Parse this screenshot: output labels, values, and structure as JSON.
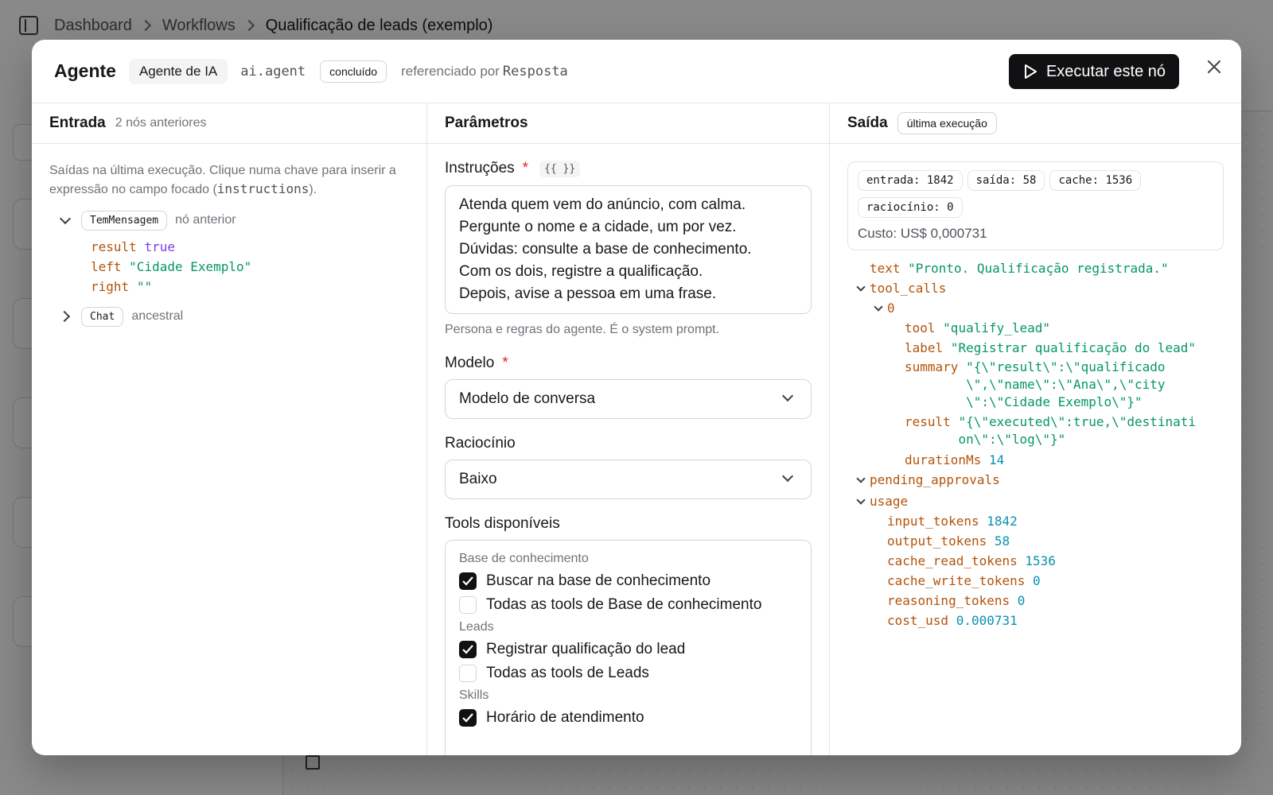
{
  "breadcrumb": [
    "Dashboard",
    "Workflows",
    "Qualificação de leads (exemplo)"
  ],
  "modal": {
    "title": "Agente",
    "kind_label": "Agente de IA",
    "type": "ai.agent",
    "status": "concluído",
    "referenced_by_label": "referenciado por",
    "referenced_by": "Resposta",
    "run_button": "Executar este nó",
    "close_icon": "close-icon"
  },
  "entrada": {
    "title": "Entrada",
    "subtitle": "2 nós anteriores",
    "hint_before": "Saídas na última execução. Clique numa chave para inserir a expressão no campo focado (",
    "hint_code": "instructions",
    "hint_after": ").",
    "nodes": [
      {
        "name": "TemMensagem",
        "tag": "nó anterior",
        "expanded": true,
        "fields": [
          {
            "key": "result",
            "value": "true"
          },
          {
            "key": "left",
            "value": "\"Cidade Exemplo\""
          },
          {
            "key": "right",
            "value": "\"\""
          }
        ]
      },
      {
        "name": "Chat",
        "tag": "ancestral",
        "expanded": false
      }
    ]
  },
  "parametros": {
    "title": "Parâmetros",
    "instructions_label": "Instruções",
    "required_mark": "*",
    "expr_badge": "{{ }}",
    "instructions_lines": [
      "Atenda quem vem do anúncio, com calma.",
      "Pergunte o nome e a cidade, um por vez.",
      "Dúvidas: consulte a base de conhecimento.",
      "Com os dois, registre a qualificação.",
      "Depois, avise a pessoa em uma frase."
    ],
    "instructions_help": "Persona e regras do agente. É o system prompt.",
    "model_label": "Modelo",
    "model_value": "Modelo de conversa",
    "reasoning_label": "Raciocínio",
    "reasoning_value": "Baixo",
    "tools_label": "Tools disponíveis",
    "tool_groups": [
      {
        "label": "Base de conhecimento",
        "items": [
          {
            "label": "Buscar na base de conhecimento",
            "checked": true
          },
          {
            "label": "Todas as tools de Base de conhecimento",
            "checked": false
          }
        ]
      },
      {
        "label": "Leads",
        "items": [
          {
            "label": "Registrar qualificação do lead",
            "checked": true
          },
          {
            "label": "Todas as tools de Leads",
            "checked": false
          }
        ]
      },
      {
        "label": "Skills",
        "items": [
          {
            "label": "Horário de atendimento",
            "checked": true
          }
        ]
      }
    ]
  },
  "saida": {
    "title": "Saída",
    "badge": "última execução",
    "chips": [
      "entrada: 1842",
      "saída: 58",
      "cache: 1536",
      "raciocínio: 0"
    ],
    "cost": "Custo: US$ 0,000731",
    "text_key": "text",
    "text_value": "\"Pronto. Qualificação registrada.\"",
    "tool_calls_key": "tool_calls",
    "index_key": "0",
    "call": {
      "tool_key": "tool",
      "tool_value": "\"qualify_lead\"",
      "label_key": "label",
      "label_value": "\"Registrar qualificação do lead\"",
      "summary_key": "summary",
      "summary_value": "\"{\\\"result\\\":\\\"qualificado\\\",\\\"name\\\":\\\"Ana\\\",\\\"city\\\":\\\"Cidade Exemplo\\\"}\"",
      "result_key": "result",
      "result_value": "\"{\\\"executed\\\":true,\\\"destination\\\":\\\"log\\\"}\"",
      "duration_key": "durationMs",
      "duration_value": "14"
    },
    "pending_key": "pending_approvals",
    "usage_key": "usage",
    "usage": [
      {
        "key": "input_tokens",
        "value": "1842"
      },
      {
        "key": "output_tokens",
        "value": "58"
      },
      {
        "key": "cache_read_tokens",
        "value": "1536"
      },
      {
        "key": "cache_write_tokens",
        "value": "0"
      },
      {
        "key": "reasoning_tokens",
        "value": "0"
      },
      {
        "key": "cost_usd",
        "value": "0.000731"
      }
    ]
  }
}
